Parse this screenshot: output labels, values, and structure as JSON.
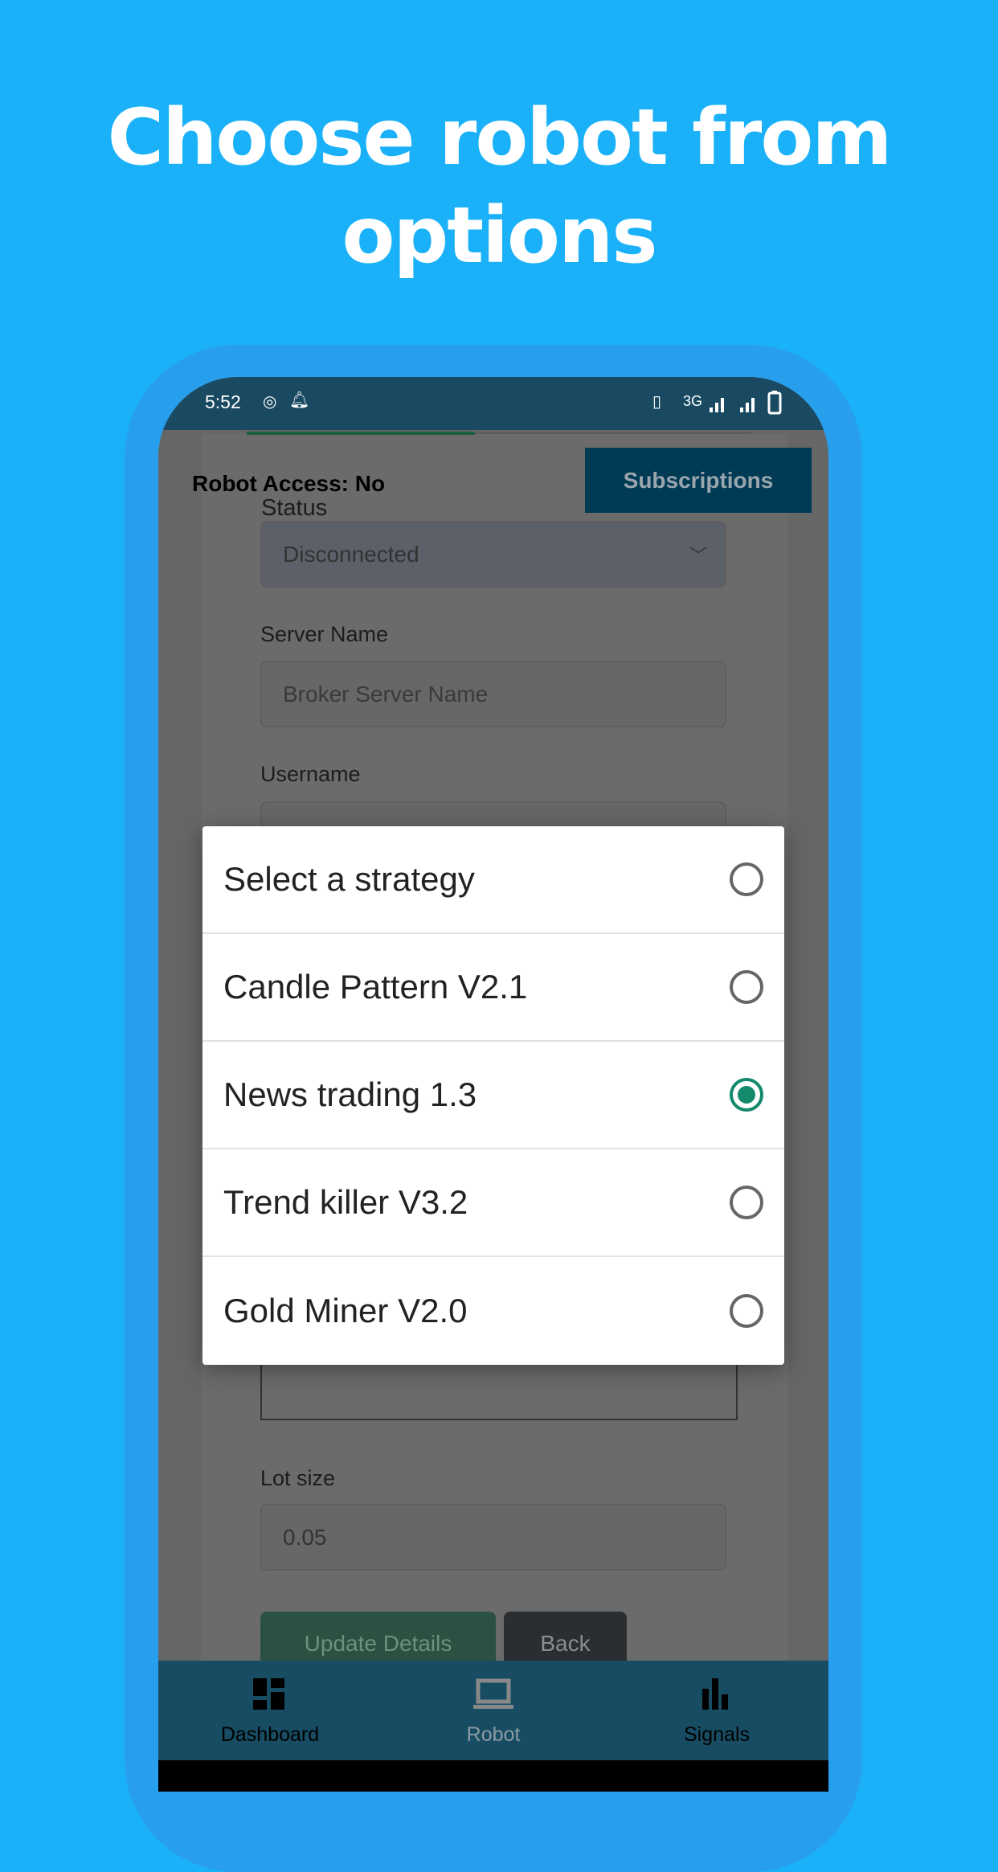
{
  "headline": [
    "Choose robot from",
    "options"
  ],
  "status_bar": {
    "time": "5:52",
    "network": "3G"
  },
  "header": {
    "robot_access": "Robot Access: No",
    "subscriptions_button": "Subscriptions"
  },
  "form": {
    "status_label": "Status",
    "status_value": "Disconnected",
    "server_label": "Server Name",
    "server_placeholder": "Broker Server Name",
    "username_label": "Username",
    "lot_label": "Lot size",
    "lot_value": "0.05",
    "update_button": "Update Details",
    "back_button": "Back"
  },
  "dialog": {
    "options": [
      {
        "label": "Select a strategy",
        "selected": false
      },
      {
        "label": "Candle Pattern V2.1",
        "selected": false
      },
      {
        "label": "News trading 1.3",
        "selected": true
      },
      {
        "label": "Trend killer V3.2",
        "selected": false
      },
      {
        "label": "Gold Miner V2.0",
        "selected": false
      }
    ]
  },
  "nav": {
    "items": [
      {
        "label": "Dashboard",
        "icon": "dashboard-icon",
        "active": false
      },
      {
        "label": "Robot",
        "icon": "laptop-icon",
        "active": true
      },
      {
        "label": "Signals",
        "icon": "bar-chart-icon",
        "active": false
      }
    ]
  },
  "colors": {
    "background": "#1bb1f9",
    "accent": "#138a6c",
    "nav": "#174c63"
  }
}
